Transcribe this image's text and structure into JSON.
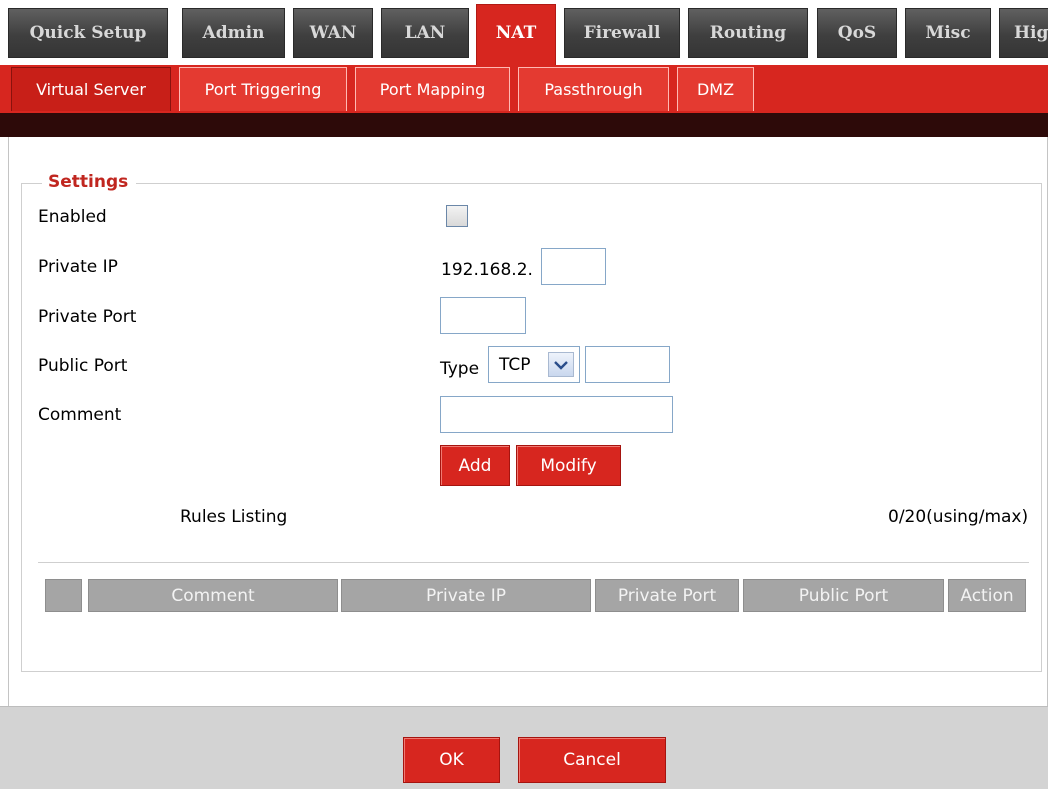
{
  "top_tabs": [
    "Quick Setup",
    "Admin",
    "WAN",
    "LAN",
    "NAT",
    "Firewall",
    "Routing",
    "QoS",
    "Misc",
    "Hig"
  ],
  "active_top_tab": "NAT",
  "sub_tabs": [
    "Virtual Server",
    "Port Triggering",
    "Port Mapping",
    "Passthrough",
    "DMZ"
  ],
  "active_sub_tab": "Virtual Server",
  "settings": {
    "legend": "Settings",
    "enabled_label": "Enabled",
    "enabled_checked": false,
    "private_ip_label": "Private IP",
    "private_ip_prefix": "192.168.2.",
    "private_ip_value": "",
    "private_port_label": "Private Port",
    "private_port_value": "",
    "public_port_label": "Public Port",
    "type_label": "Type",
    "type_selected": "TCP",
    "public_port_value": "",
    "comment_label": "Comment",
    "comment_value": "",
    "add_label": "Add",
    "modify_label": "Modify"
  },
  "rules": {
    "title": "Rules Listing",
    "count": "0/20(using/max)",
    "columns": [
      "",
      "Comment",
      "Private IP",
      "Private Port",
      "Public Port",
      "Action"
    ]
  },
  "footer": {
    "ok_label": "OK",
    "cancel_label": "Cancel"
  },
  "colors": {
    "accent_red": "#d7261f",
    "tab_dark": "#3f3f3f",
    "table_header": "#a5a5a5"
  }
}
